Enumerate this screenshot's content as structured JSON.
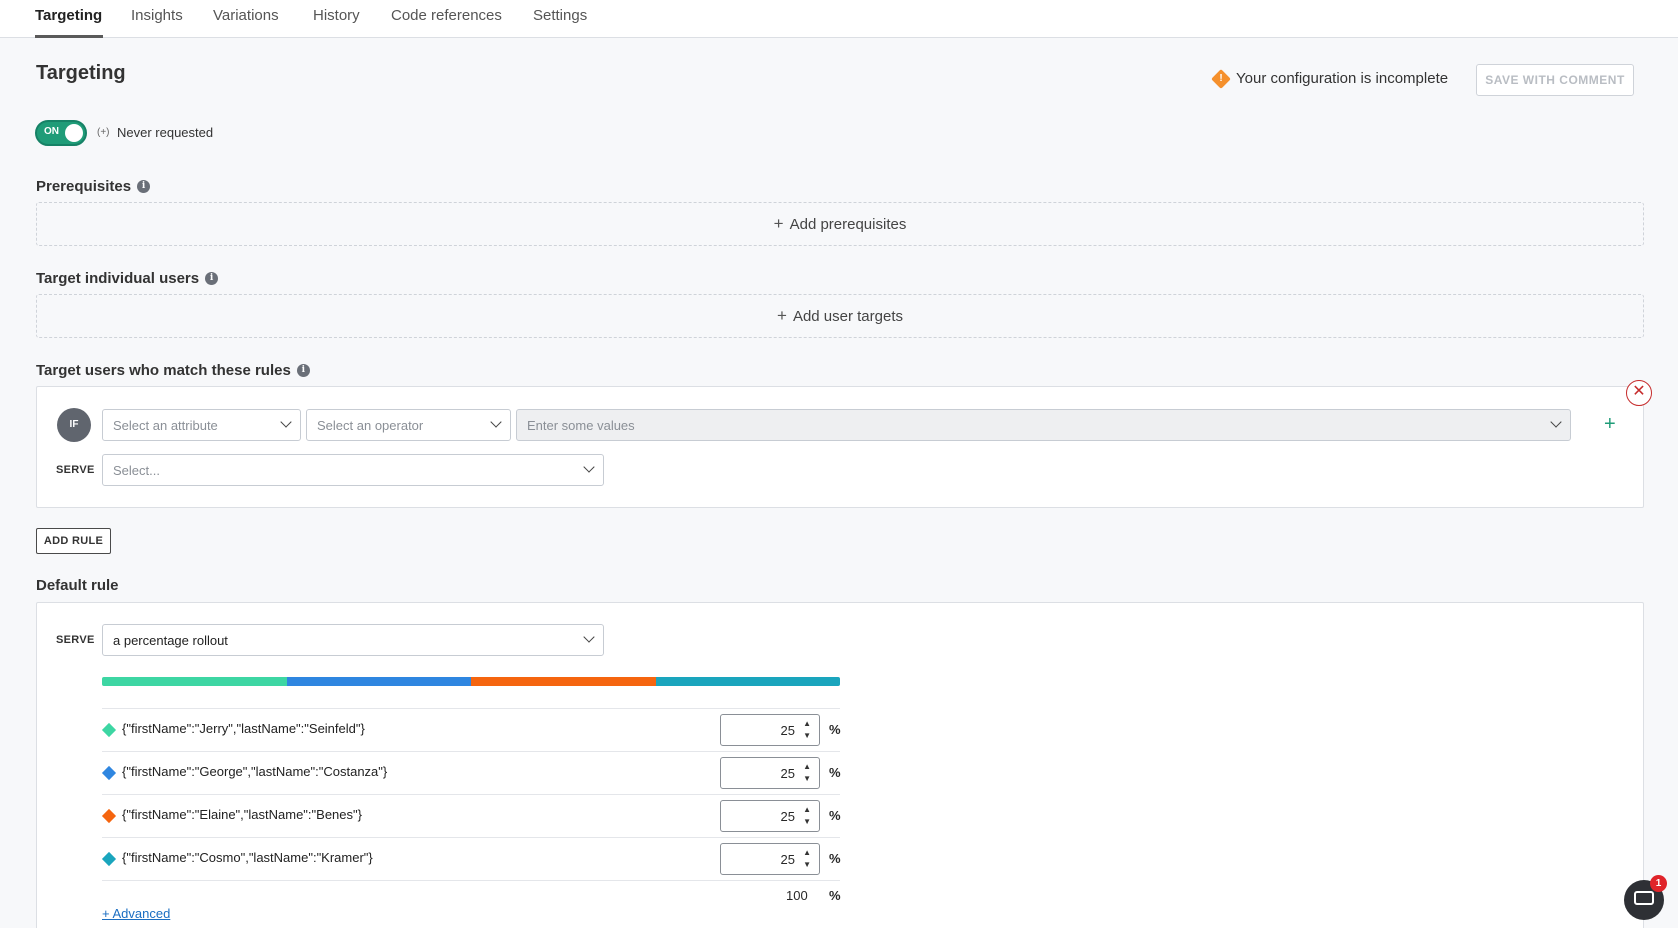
{
  "tabs": [
    {
      "label": "Targeting",
      "active": true
    },
    {
      "label": "Insights"
    },
    {
      "label": "Variations"
    },
    {
      "label": "History"
    },
    {
      "label": "Code references"
    },
    {
      "label": "Settings"
    }
  ],
  "page": {
    "title": "Targeting"
  },
  "status": {
    "incomplete_text": "Your configuration is incomplete",
    "warning_glyph": "!",
    "save_label": "SAVE WITH COMMENT"
  },
  "toggle": {
    "label": "ON",
    "state": "on",
    "evaluation_icon": "(+)",
    "evaluation_text": "Never requested"
  },
  "prerequisites": {
    "label": "Prerequisites",
    "add_label": "Add prerequisites"
  },
  "individual": {
    "label": "Target individual users",
    "add_label": "Add user targets"
  },
  "rules": {
    "label": "Target users who match these rules",
    "if_label": "IF",
    "attribute_placeholder": "Select an attribute",
    "operator_placeholder": "Select an operator",
    "values_placeholder": "Enter some values",
    "serve_label": "SERVE",
    "serve_placeholder": "Select...",
    "add_rule_label": "ADD RULE"
  },
  "default_rule": {
    "label": "Default rule",
    "serve_label": "SERVE",
    "serve_value": "a percentage rollout",
    "variations": [
      {
        "name": "{\"firstName\":\"Jerry\",\"lastName\":\"Seinfeld\"}",
        "percent": "25",
        "color": "#3dd6a3"
      },
      {
        "name": "{\"firstName\":\"George\",\"lastName\":\"Costanza\"}",
        "percent": "25",
        "color": "#2f86e0"
      },
      {
        "name": "{\"firstName\":\"Elaine\",\"lastName\":\"Benes\"}",
        "percent": "25",
        "color": "#f5650f"
      },
      {
        "name": "{\"firstName\":\"Cosmo\",\"lastName\":\"Kramer\"}",
        "percent": "25",
        "color": "#1aa5bd"
      }
    ],
    "percent_sign": "%",
    "total": "100",
    "advanced_label": "+ Advanced"
  },
  "chat": {
    "badge_count": "1"
  }
}
